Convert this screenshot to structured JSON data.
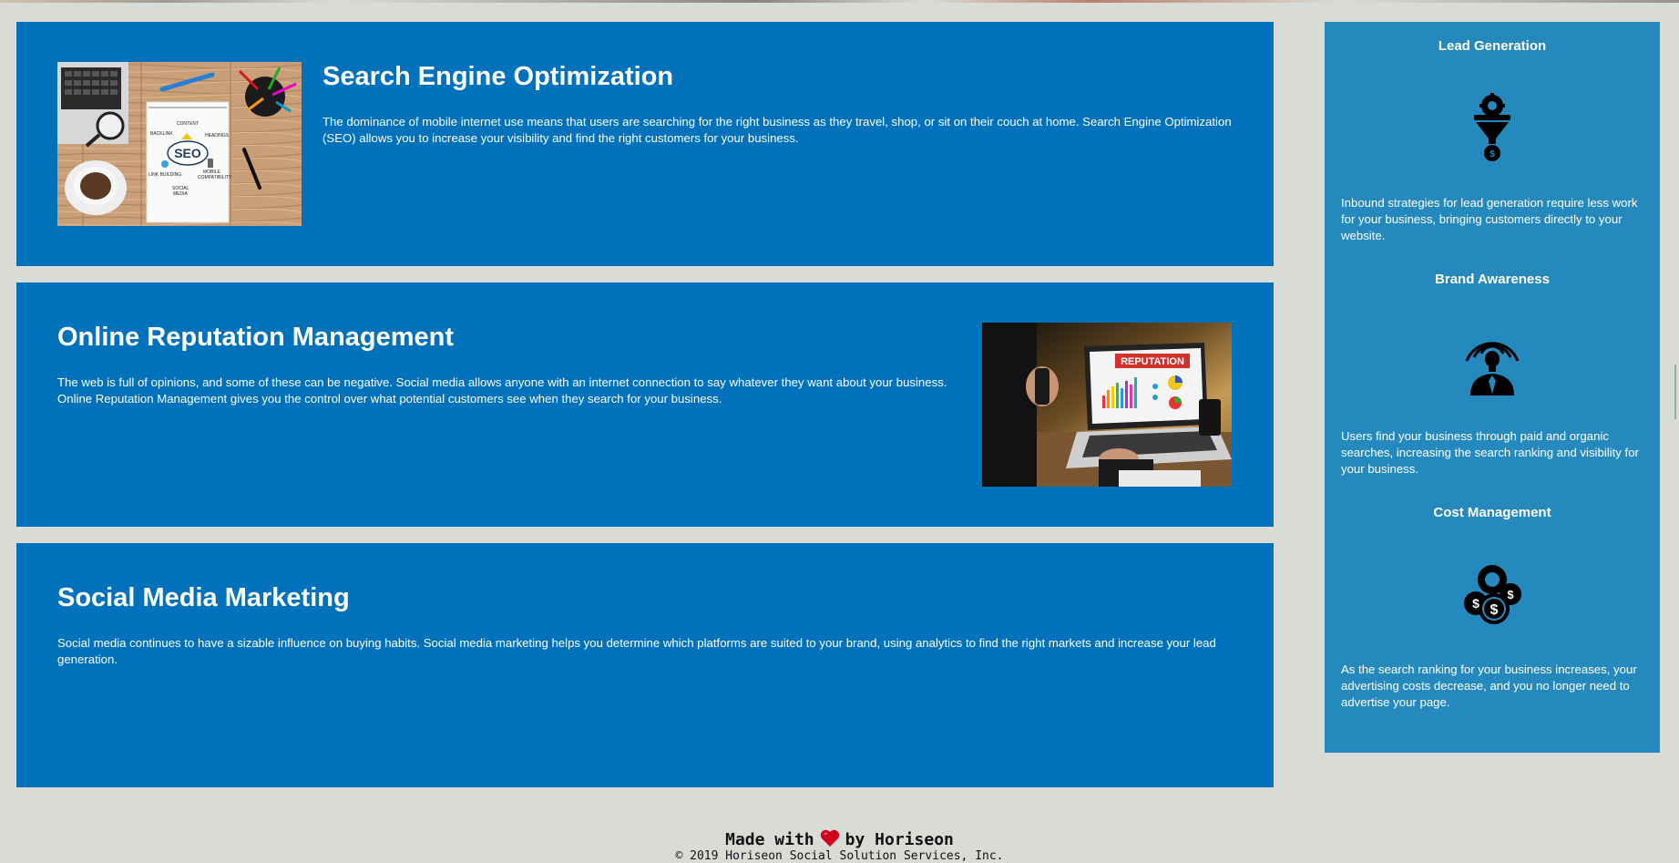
{
  "sections": {
    "seo": {
      "title": "Search Engine Optimization",
      "text": "The dominance of mobile internet use means that users are searching for the right business as they travel, shop, or sit on their couch at home. Search Engine Optimization (SEO) allows you to increase your visibility and find the right customers for your business.",
      "image_labels": {
        "center": "SEO",
        "content": "CONTENT",
        "backlink": "BACKLINK",
        "headings": "HEADINGS",
        "link_building": "LINK BUILDING",
        "mobile": "MOBILE",
        "compatibility": "COMPATIBILITY",
        "social": "SOCIAL",
        "media": "MEDIA"
      }
    },
    "orm": {
      "title": "Online Reputation Management",
      "text": "The web is full of opinions, and some of these can be negative. Social media allows anyone with an internet connection to say whatever they want about your business. Online Reputation Management gives you the control over what potential customers see when they search for your business.",
      "image_label": "REPUTATION"
    },
    "smm": {
      "title": "Social Media Marketing",
      "text": "Social media continues to have a sizable influence on buying habits. Social media marketing helps you determine which platforms are suited to your brand, using analytics to find the right markets and increase your lead generation."
    }
  },
  "sidebar": {
    "items": [
      {
        "title": "Lead Generation",
        "icon": "lead-generation-funnel-icon",
        "text": "Inbound strategies for lead generation require less work for your business, bringing customers directly to your website."
      },
      {
        "title": "Brand Awareness",
        "icon": "brand-awareness-lightbulb-icon",
        "text": "Users find your business through paid and organic searches, increasing the search ranking and visibility for your business."
      },
      {
        "title": "Cost Management",
        "icon": "cost-management-coins-icon",
        "text": "As the search ranking for your business increases, your advertising costs decrease, and you no longer need to advertise your page."
      }
    ]
  },
  "footer": {
    "made_with": "Made with",
    "by": "by Horiseon",
    "copyright": "© 2019 Horiseon Social Solution Services, Inc."
  },
  "colors": {
    "page_bg": "#d9dcd6",
    "card_bg": "#0072bb",
    "sidebar_bg": "#2589bd",
    "heart": "#d1001c"
  }
}
